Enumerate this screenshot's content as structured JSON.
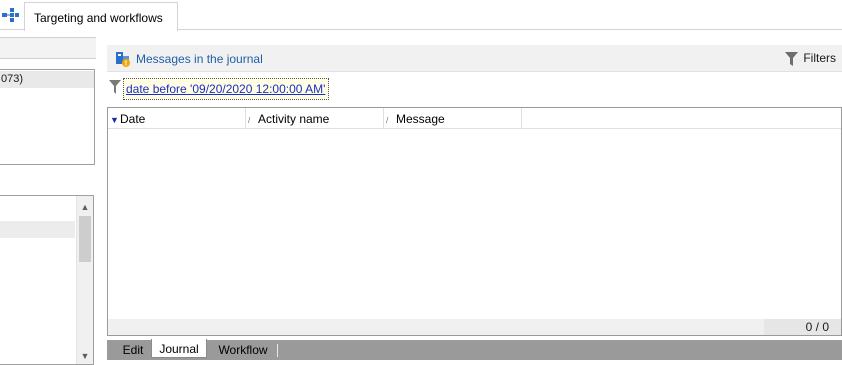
{
  "topbar": {
    "app_icon": "workflow-app-icon",
    "tab_label": "Targeting and workflows"
  },
  "left": {
    "box_row_text": "073)"
  },
  "journal": {
    "icon": "journal-messages-icon",
    "title": "Messages in the journal",
    "filters_label": "Filters",
    "filters_icon": "funnel-icon",
    "filter_condition": "date before '09/20/2020 12:00:00 AM'"
  },
  "grid": {
    "columns": [
      "Date",
      "Activity name",
      "Message"
    ],
    "rows": [],
    "count": "0 / 0"
  },
  "bottom_tabs": [
    "Edit",
    "Journal",
    "Workflow"
  ],
  "active_tab": "Journal",
  "colors": {
    "link_blue": "#1a2fc8",
    "title_blue": "#1f5fa8",
    "filter_chip_bg": "#fffde3",
    "tabbar_gray": "#9a9a9a"
  }
}
